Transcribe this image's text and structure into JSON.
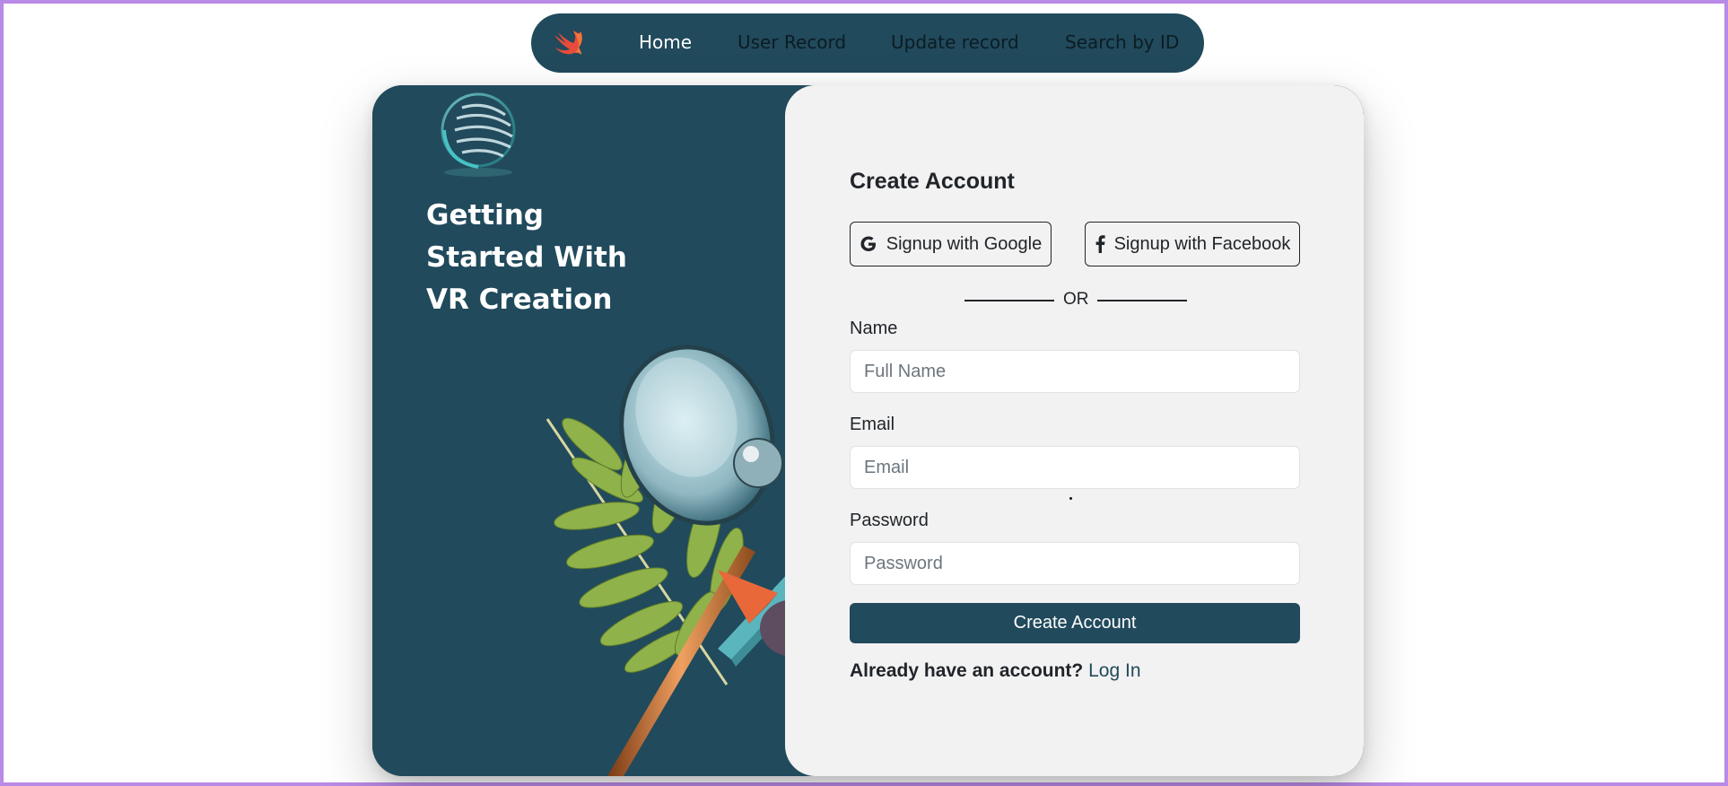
{
  "nav": {
    "logo_icon": "swift-logo-icon",
    "items": [
      {
        "label": "Home",
        "active": true
      },
      {
        "label": "User Record",
        "active": false
      },
      {
        "label": "Update record",
        "active": false
      },
      {
        "label": "Search by ID",
        "active": false
      }
    ]
  },
  "hero": {
    "headline": [
      "Getting",
      "Started With",
      "VR Creation"
    ],
    "brand_icon": "globe-logo-icon"
  },
  "form": {
    "title": "Create Account",
    "google_label": "Signup with Google",
    "facebook_label": "Signup with Facebook",
    "divider_text": "OR",
    "name_label": "Name",
    "name_placeholder": "Full Name",
    "email_label": "Email",
    "email_placeholder": "Email",
    "password_label": "Password",
    "password_placeholder": "Password",
    "submit_label": "Create Account",
    "login_prompt": "Already have an account?",
    "login_link": "Log In"
  },
  "colors": {
    "primary": "#214a5c",
    "panel": "#f2f2f2",
    "frame": "#b98ae6"
  }
}
